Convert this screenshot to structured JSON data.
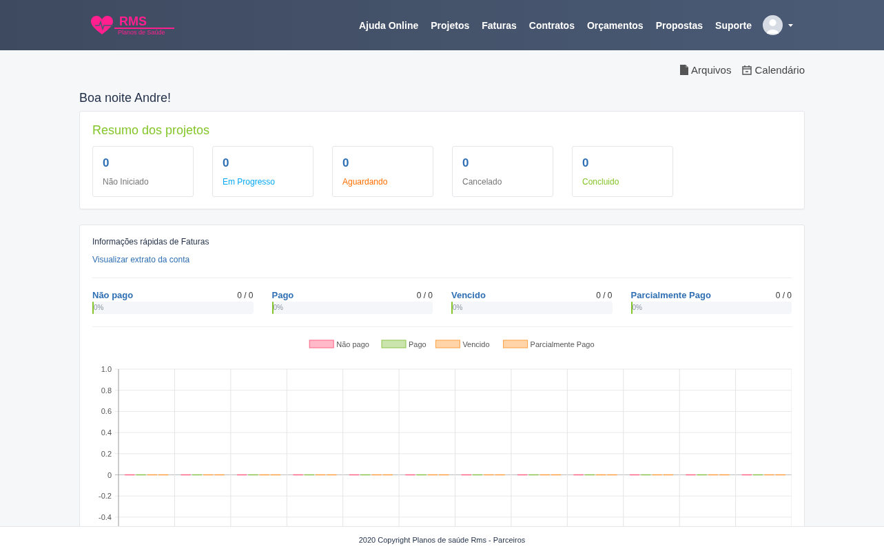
{
  "navbar": {
    "logo": {
      "title": "RMS",
      "subtitle": "Planos de Saúde"
    },
    "links": [
      "Ajuda Online",
      "Projetos",
      "Faturas",
      "Contratos",
      "Orçamentos",
      "Propostas",
      "Suporte"
    ]
  },
  "toolbar": [
    {
      "kind": "file",
      "label": "Arquivos"
    },
    {
      "kind": "calendar",
      "label": "Calendário"
    }
  ],
  "greeting": "Boa noite Andre!",
  "project_summary": {
    "title": "Resumo dos projetos",
    "stats": [
      {
        "count": "0",
        "label": "Não Iniciado",
        "color": "#777777"
      },
      {
        "count": "0",
        "label": "Em Progresso",
        "color": "#03a9f4"
      },
      {
        "count": "0",
        "label": "Aguardando",
        "color": "#ff6f00"
      },
      {
        "count": "0",
        "label": "Cancelado",
        "color": "#777777"
      },
      {
        "count": "0",
        "label": "Concluido",
        "color": "#84c529"
      }
    ]
  },
  "invoices": {
    "title": "Informações rápidas de Faturas",
    "link": "Visualizar extrato da conta",
    "progress": [
      {
        "label": "Não pago",
        "reading": "0 / 0",
        "level": 0,
        "percent": "0%"
      },
      {
        "label": "Pago",
        "reading": "0 / 0",
        "level": 0,
        "percent": "0%"
      },
      {
        "label": "Vencido",
        "reading": "0 / 0",
        "level": 0,
        "percent": "0%"
      },
      {
        "label": "Parcialmente Pago",
        "reading": "0 / 0",
        "level": 0,
        "percent": "0%"
      }
    ],
    "chart_data": {
      "type": "bar",
      "grid": true,
      "legend": "top",
      "ylim": [
        -0.5,
        1.0
      ],
      "yticks": [
        {
          "value": 1.0,
          "label": "1.0"
        },
        {
          "value": 0.8,
          "label": "0.8"
        },
        {
          "value": 0.6,
          "label": "0.6"
        },
        {
          "value": 0.4,
          "label": "0.4"
        },
        {
          "value": 0.2,
          "label": "0.2"
        },
        {
          "value": 0,
          "label": "0"
        },
        {
          "value": -0.2,
          "label": "-0.2"
        },
        {
          "value": -0.4,
          "label": "-0.4"
        }
      ],
      "series": [
        {
          "name": "Não pago",
          "color": "#ff6384",
          "values": [
            0,
            0,
            0,
            0,
            0,
            0,
            0,
            0,
            0,
            0,
            0,
            0
          ]
        },
        {
          "name": "Pago",
          "color": "#8bc34a",
          "values": [
            0,
            0,
            0,
            0,
            0,
            0,
            0,
            0,
            0,
            0,
            0,
            0
          ]
        },
        {
          "name": "Vencido",
          "color": "#ff9f40",
          "values": [
            0,
            0,
            0,
            0,
            0,
            0,
            0,
            0,
            0,
            0,
            0,
            0
          ]
        },
        {
          "name": "Parcialmente Pago",
          "color": "#ff9f40",
          "values": [
            0,
            0,
            0,
            0,
            0,
            0,
            0,
            0,
            0,
            0,
            0,
            0
          ]
        }
      ]
    }
  },
  "footer": "2020 Copyright Planos de saúde Rms - Parceiros"
}
